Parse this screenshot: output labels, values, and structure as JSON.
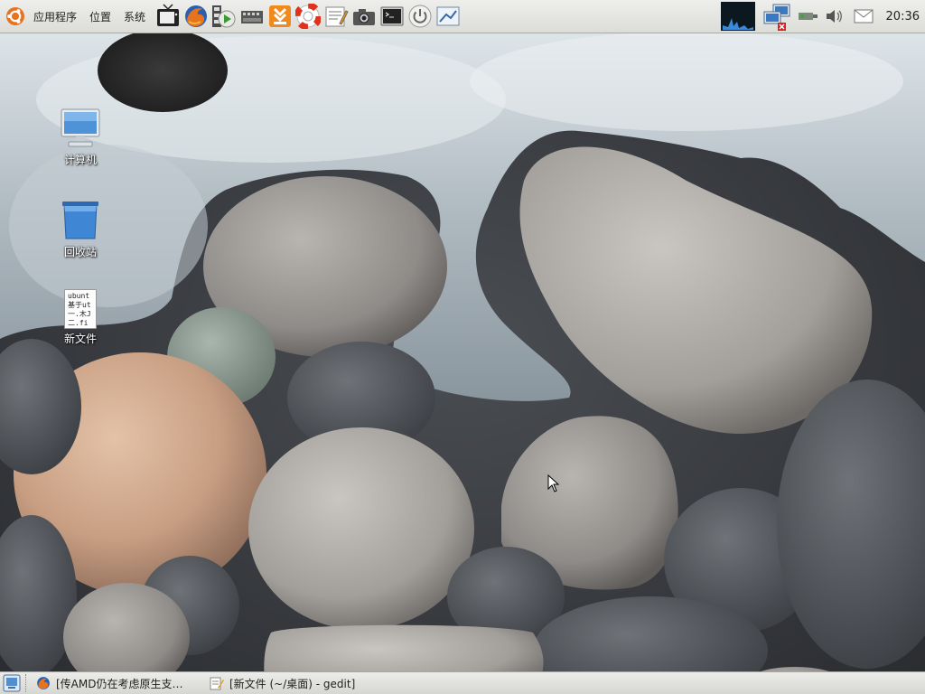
{
  "top_panel": {
    "menus": [
      "应用程序",
      "位置",
      "系统"
    ],
    "launchers": [
      "tv-icon",
      "firefox-icon",
      "media-player-icon",
      "film-icon",
      "download-icon",
      "help-lifebuoy-icon",
      "text-editor-icon",
      "camera-icon",
      "terminal-icon",
      "power-icon",
      "network-tool-icon"
    ],
    "tray": [
      "system-monitor-icon",
      "network-status-icon",
      "usb-device-icon",
      "volume-icon",
      "mail-icon"
    ],
    "clock": "20:36"
  },
  "desktop": {
    "icons": [
      {
        "label": "计算机",
        "icon": "computer-icon"
      },
      {
        "label": "回收站",
        "icon": "trash-icon"
      },
      {
        "label": "新文件",
        "icon": "text-file-icon",
        "preview_lines": [
          "ubunt",
          "基于ut",
          "一.木J",
          "二.fi"
        ]
      }
    ]
  },
  "bottom_panel": {
    "tasks": [
      {
        "label": "[传AMD仍在考虑原生支…",
        "icon": "firefox-icon"
      },
      {
        "label": "[新文件 (~/桌面) - gedit]",
        "icon": "gedit-icon"
      }
    ]
  },
  "colors": {
    "panel": "#e6e6e2",
    "accent_orange": "#e8731e",
    "wallpaper": "#6b6d70"
  }
}
